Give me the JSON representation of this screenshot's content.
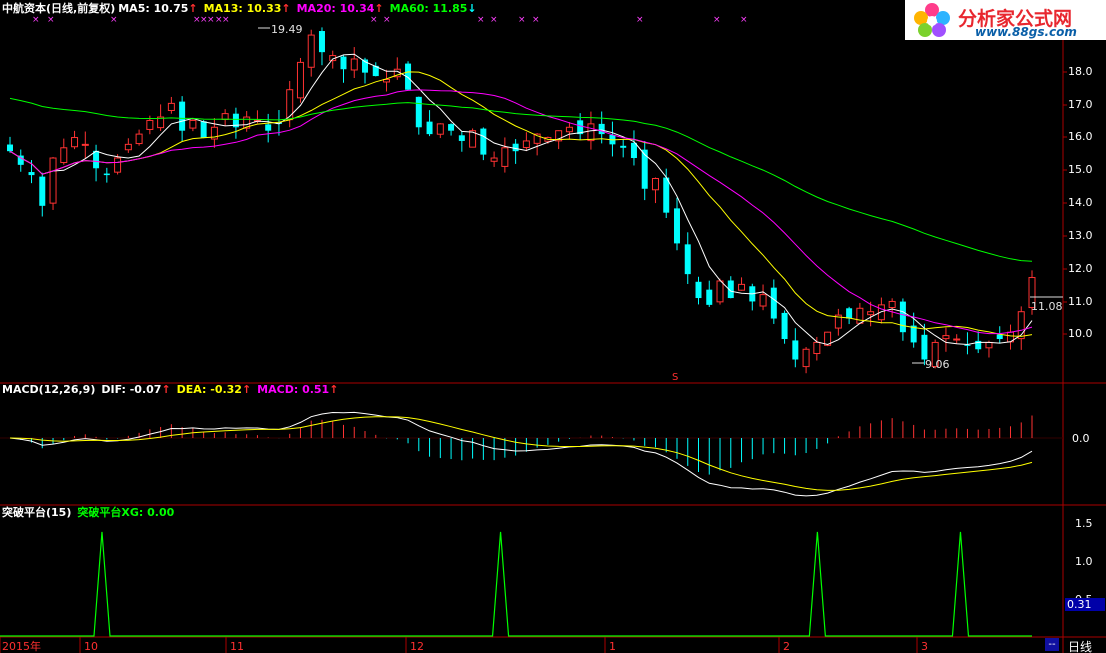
{
  "main_header": {
    "title": "中航资本(日线,前复权)",
    "ma5": "MA5: 10.75",
    "ma13": "MA13: 10.33",
    "ma20": "MA20: 10.34",
    "ma60": "MA60: 11.85",
    "up_arrow": "↑",
    "down_arrow": "↓"
  },
  "macd_header": {
    "title": "MACD(12,26,9)",
    "dif": "DIF: -0.07",
    "dea": "DEA: -0.32",
    "macd": "MACD: 0.51",
    "up_arrow": "↑"
  },
  "xg_header": {
    "title": "突破平台(15)",
    "xg": "突破平台XG: 0.00"
  },
  "annotations": {
    "high": "19.49",
    "low": "9.06",
    "last": "11.08",
    "marker": "S"
  },
  "logo": {
    "text": "分析家公式网",
    "url": "www.88gs.com"
  },
  "status_value": "0.31",
  "bottom_right": "日线",
  "bottom_dash": "--",
  "colors": {
    "up": "#ff3232",
    "down": "#00ffff",
    "ma5": "#ffffff",
    "ma13": "#ffff00",
    "ma20": "#ff00ff",
    "ma60": "#00ff00",
    "grid": "#aa0000"
  },
  "chart_data": [
    {
      "type": "candlestick",
      "name": "price",
      "y_ticks": [
        "18.0",
        "17.0",
        "16.0",
        "15.0",
        "14.0",
        "13.0",
        "12.0",
        "11.0",
        "10.0"
      ],
      "ylim": [
        9.0,
        19.6
      ],
      "x_labels": [
        "2015年",
        "10",
        "11",
        "12",
        "1",
        "2",
        "3"
      ],
      "close_path": [
        15.7,
        15.3,
        15.0,
        14.1,
        15.5,
        15.8,
        16.1,
        15.9,
        15.2,
        15.0,
        15.5,
        15.9,
        16.2,
        16.6,
        16.7,
        17.1,
        16.3,
        16.6,
        16.1,
        16.4,
        16.8,
        16.4,
        16.7,
        16.6,
        16.3,
        16.5,
        17.5,
        18.3,
        19.1,
        18.6,
        18.5,
        18.1,
        18.4,
        18.0,
        17.9,
        17.8,
        18.1,
        17.5,
        16.4,
        16.2,
        16.5,
        16.3,
        16.0,
        16.3,
        15.6,
        15.5,
        15.8,
        15.7,
        16.0,
        16.2,
        16.1,
        16.3,
        16.4,
        16.2,
        16.5,
        16.2,
        15.9,
        15.8,
        15.5,
        14.6,
        14.9,
        13.9,
        13.0,
        12.1,
        11.4,
        11.2,
        11.9,
        11.4,
        11.8,
        11.3,
        11.5,
        10.8,
        10.2,
        9.6,
        9.9,
        10.1,
        10.4,
        10.9,
        10.8,
        11.1,
        11.0,
        11.2,
        11.3,
        10.4,
        10.1,
        9.6,
        10.1,
        10.3,
        10.2,
        10.0,
        9.9,
        10.1,
        10.2,
        10.4,
        11.0,
        12.0
      ],
      "ma_values": {
        "MA5": 10.75,
        "MA13": 10.33,
        "MA20": 10.34,
        "MA60": 11.85
      },
      "high": 19.49,
      "low": 9.06,
      "last": 11.08
    },
    {
      "type": "bar",
      "name": "MACD(12,26,9)",
      "y_ticks": [
        "0.0"
      ],
      "values": {
        "DIF": -0.07,
        "DEA": -0.32,
        "MACD": 0.51
      }
    },
    {
      "type": "line",
      "name": "突破平台(15)",
      "y_ticks": [
        "1.5",
        "1.0",
        "0.5"
      ],
      "ylim": [
        0,
        1.7
      ],
      "spikes_at_fraction": [
        0.09,
        0.48,
        0.79,
        0.93
      ],
      "spike_value": 1.5,
      "values": {
        "XG": 0.0
      }
    }
  ]
}
